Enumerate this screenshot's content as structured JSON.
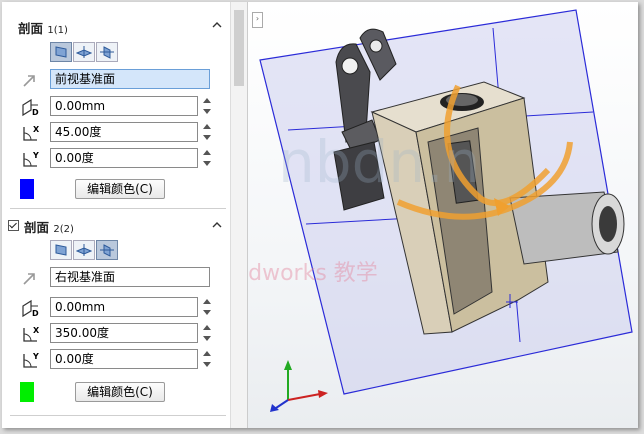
{
  "section1": {
    "title": "剖面",
    "title_sub": "1(1)",
    "plane_value": "前视基准面",
    "offset_value": "0.00mm",
    "rot_x_value": "45.00度",
    "rot_y_value": "0.00度",
    "edit_color_label": "编辑颜色(C)",
    "swatch_color": "#0000ff",
    "offset_icon_letter": "D",
    "rot_x_letter": "X",
    "rot_y_letter": "Y"
  },
  "section2": {
    "title": "剖面",
    "title_sub": "2(2)",
    "plane_value": "右视基准面",
    "offset_value": "0.00mm",
    "rot_x_value": "350.00度",
    "rot_y_value": "0.00度",
    "edit_color_label": "编辑颜色(C)",
    "swatch_color": "#00ee00",
    "offset_icon_letter": "D",
    "rot_x_letter": "X",
    "rot_y_letter": "Y"
  },
  "watermark": {
    "line1": "nbdn.n",
    "line2": "犯来师 solidworks 教学"
  },
  "colors": {
    "plane_blue": "#2b2bd8",
    "arrow_orange": "#f0a030",
    "part_body": "#cfc5b0"
  }
}
